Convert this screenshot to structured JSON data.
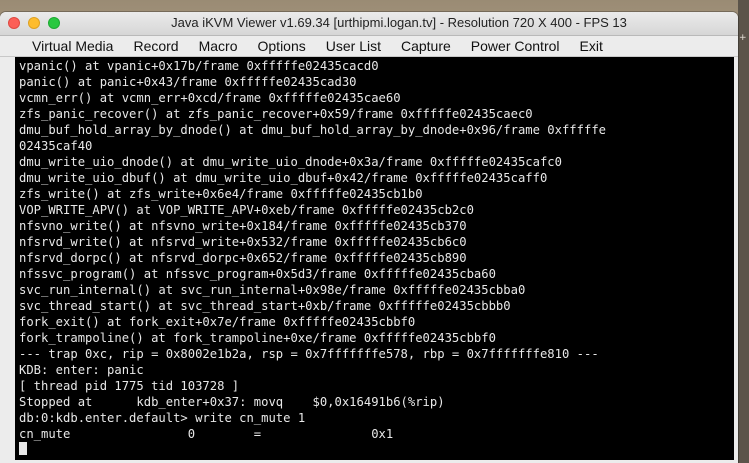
{
  "window": {
    "title": "Java iKVM Viewer v1.69.34 [urthipmi.logan.tv]  - Resolution 720 X 400 - FPS 13"
  },
  "menu": [
    {
      "label": "Virtual Media"
    },
    {
      "label": "Record"
    },
    {
      "label": "Macro"
    },
    {
      "label": "Options"
    },
    {
      "label": "User List"
    },
    {
      "label": "Capture"
    },
    {
      "label": "Power Control"
    },
    {
      "label": "Exit"
    }
  ],
  "console": {
    "lines": [
      "vpanic() at vpanic+0x17b/frame 0xfffffe02435cacd0",
      "panic() at panic+0x43/frame 0xfffffe02435cad30",
      "vcmn_err() at vcmn_err+0xcd/frame 0xfffffe02435cae60",
      "zfs_panic_recover() at zfs_panic_recover+0x59/frame 0xfffffe02435caec0",
      "dmu_buf_hold_array_by_dnode() at dmu_buf_hold_array_by_dnode+0x96/frame 0xfffffe",
      "02435caf40",
      "dmu_write_uio_dnode() at dmu_write_uio_dnode+0x3a/frame 0xfffffe02435cafc0",
      "dmu_write_uio_dbuf() at dmu_write_uio_dbuf+0x42/frame 0xfffffe02435caff0",
      "zfs_write() at zfs_write+0x6e4/frame 0xfffffe02435cb1b0",
      "VOP_WRITE_APV() at VOP_WRITE_APV+0xeb/frame 0xfffffe02435cb2c0",
      "nfsvno_write() at nfsvno_write+0x184/frame 0xfffffe02435cb370",
      "nfsrvd_write() at nfsrvd_write+0x532/frame 0xfffffe02435cb6c0",
      "nfsrvd_dorpc() at nfsrvd_dorpc+0x652/frame 0xfffffe02435cb890",
      "nfssvc_program() at nfssvc_program+0x5d3/frame 0xfffffe02435cba60",
      "svc_run_internal() at svc_run_internal+0x98e/frame 0xfffffe02435cbba0",
      "svc_thread_start() at svc_thread_start+0xb/frame 0xfffffe02435cbbb0",
      "fork_exit() at fork_exit+0x7e/frame 0xfffffe02435cbbf0",
      "fork_trampoline() at fork_trampoline+0xe/frame 0xfffffe02435cbbf0",
      "--- trap 0xc, rip = 0x8002e1b2a, rsp = 0x7fffffffe578, rbp = 0x7fffffffe810 ---",
      "KDB: enter: panic",
      "[ thread pid 1775 tid 103728 ]",
      "Stopped at      kdb_enter+0x37: movq    $0,0x16491b6(%rip)",
      "db:0:kdb.enter.default> write cn_mute 1",
      "cn_mute                0        =               0x1"
    ]
  }
}
